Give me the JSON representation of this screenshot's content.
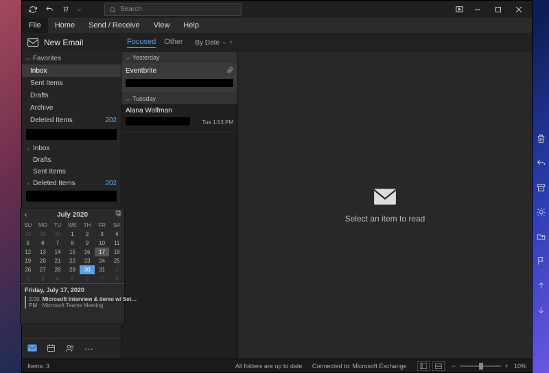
{
  "titlebar": {
    "search_placeholder": "Search"
  },
  "menubar": {
    "items": [
      "File",
      "Home",
      "Send / Receive",
      "View",
      "Help"
    ]
  },
  "toolbar": {
    "new_email": "New Email",
    "tabs": {
      "focused": "Focused",
      "other": "Other"
    },
    "sort": "By Date"
  },
  "folders": {
    "favorites_header": "Favorites",
    "favorites": [
      {
        "name": "Inbox",
        "count": ""
      },
      {
        "name": "Sent Items",
        "count": ""
      },
      {
        "name": "Drafts",
        "count": ""
      },
      {
        "name": "Archive",
        "count": ""
      },
      {
        "name": "Deleted Items",
        "count": "202"
      }
    ],
    "tree": [
      {
        "name": "Inbox",
        "count": "",
        "caret": "›"
      },
      {
        "name": "Drafts",
        "count": "",
        "caret": ""
      },
      {
        "name": "Sent Items",
        "count": "",
        "caret": ""
      },
      {
        "name": "Deleted Items",
        "count": "202",
        "caret": "›"
      }
    ]
  },
  "msglist": {
    "groups": [
      {
        "label": "Yesterday"
      },
      {
        "label": "Tuesday"
      }
    ],
    "msgs": [
      {
        "from": "Eventbrite",
        "time": ""
      },
      {
        "from": "Alana Wolfman",
        "time": "Tue 1:53 PM"
      }
    ]
  },
  "reading": {
    "empty": "Select an item to read"
  },
  "statusbar": {
    "items": "Items: 3",
    "uptodate": "All folders are up to date.",
    "connected": "Connected to: Microsoft Exchange",
    "zoom": "10%"
  },
  "calendar": {
    "title": "July 2020",
    "dow": [
      "SU",
      "MO",
      "TU",
      "WE",
      "TH",
      "FR",
      "SA"
    ],
    "weeks": [
      [
        {
          "d": "28",
          "o": 1
        },
        {
          "d": "29",
          "o": 1
        },
        {
          "d": "30",
          "o": 1
        },
        {
          "d": "1"
        },
        {
          "d": "2"
        },
        {
          "d": "3"
        },
        {
          "d": "4"
        }
      ],
      [
        {
          "d": "5"
        },
        {
          "d": "6"
        },
        {
          "d": "7"
        },
        {
          "d": "8"
        },
        {
          "d": "9"
        },
        {
          "d": "10"
        },
        {
          "d": "11"
        }
      ],
      [
        {
          "d": "12"
        },
        {
          "d": "13"
        },
        {
          "d": "14"
        },
        {
          "d": "15"
        },
        {
          "d": "16"
        },
        {
          "d": "17",
          "sel": 1
        },
        {
          "d": "18"
        }
      ],
      [
        {
          "d": "19"
        },
        {
          "d": "20"
        },
        {
          "d": "21"
        },
        {
          "d": "22"
        },
        {
          "d": "23"
        },
        {
          "d": "24"
        },
        {
          "d": "25"
        }
      ],
      [
        {
          "d": "26"
        },
        {
          "d": "27"
        },
        {
          "d": "28"
        },
        {
          "d": "29"
        },
        {
          "d": "30",
          "today": 1
        },
        {
          "d": "31"
        },
        {
          "d": "1",
          "o": 1
        }
      ],
      [
        {
          "d": "2",
          "o": 1
        },
        {
          "d": "3",
          "o": 1
        },
        {
          "d": "4",
          "o": 1
        },
        {
          "d": "5",
          "o": 1
        },
        {
          "d": "6",
          "o": 1
        },
        {
          "d": "7",
          "o": 1
        },
        {
          "d": "8",
          "o": 1
        }
      ]
    ],
    "agenda_date": "Friday, July 17, 2020",
    "agenda_time": "2:00 PM",
    "agenda_title": "Microsoft Interview & demo w/ Set…",
    "agenda_sub": "Microsoft Teams Meeting"
  },
  "navicons": {
    "more": "···"
  }
}
